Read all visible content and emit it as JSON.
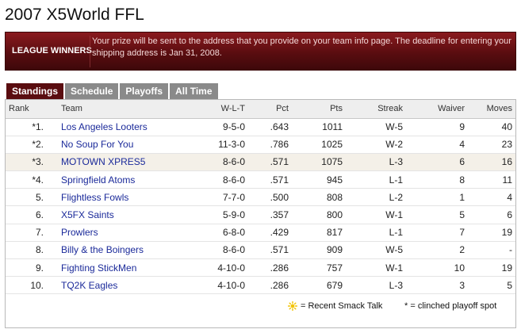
{
  "page": {
    "title": "2007 X5World FFL"
  },
  "banner": {
    "label": "LEAGUE WINNERS",
    "message": "Your prize will be sent to the address that you provide on your team info page. The deadline for entering your shipping address is Jan 31, 2008."
  },
  "tabs": [
    {
      "label": "Standings",
      "active": true
    },
    {
      "label": "Schedule",
      "active": false
    },
    {
      "label": "Playoffs",
      "active": false
    },
    {
      "label": "All Time",
      "active": false
    }
  ],
  "table": {
    "headers": {
      "rank": "Rank",
      "team": "Team",
      "wlt": "W-L-T",
      "pct": "Pct",
      "pts": "Pts",
      "streak": "Streak",
      "waiver": "Waiver",
      "moves": "Moves"
    },
    "rows": [
      {
        "rank": "*1.",
        "team": "Los Angeles Looters",
        "wlt": "9-5-0",
        "pct": ".643",
        "pts": "1011",
        "streak": "W-5",
        "waiver": "9",
        "moves": "40"
      },
      {
        "rank": "*2.",
        "team": "No Soup For You",
        "wlt": "11-3-0",
        "pct": ".786",
        "pts": "1025",
        "streak": "W-2",
        "waiver": "4",
        "moves": "23"
      },
      {
        "rank": "*3.",
        "team": "MOTOWN XPRES5",
        "wlt": "8-6-0",
        "pct": ".571",
        "pts": "1075",
        "streak": "L-3",
        "waiver": "6",
        "moves": "16",
        "highlight": true
      },
      {
        "rank": "*4.",
        "team": "Springfield Atoms",
        "wlt": "8-6-0",
        "pct": ".571",
        "pts": "945",
        "streak": "L-1",
        "waiver": "8",
        "moves": "11"
      },
      {
        "rank": "5.",
        "team": "Flightless Fowls",
        "wlt": "7-7-0",
        "pct": ".500",
        "pts": "808",
        "streak": "L-2",
        "waiver": "1",
        "moves": "4"
      },
      {
        "rank": "6.",
        "team": "X5FX Saints",
        "wlt": "5-9-0",
        "pct": ".357",
        "pts": "800",
        "streak": "W-1",
        "waiver": "5",
        "moves": "6"
      },
      {
        "rank": "7.",
        "team": "Prowlers",
        "wlt": "6-8-0",
        "pct": ".429",
        "pts": "817",
        "streak": "L-1",
        "waiver": "7",
        "moves": "19"
      },
      {
        "rank": "8.",
        "team": "Billy & the Boingers",
        "wlt": "8-6-0",
        "pct": ".571",
        "pts": "909",
        "streak": "W-5",
        "waiver": "2",
        "moves": "-"
      },
      {
        "rank": "9.",
        "team": "Fighting StickMen",
        "wlt": "4-10-0",
        "pct": ".286",
        "pts": "757",
        "streak": "W-1",
        "waiver": "10",
        "moves": "19"
      },
      {
        "rank": "10.",
        "team": "TQ2K Eagles",
        "wlt": "4-10-0",
        "pct": ".286",
        "pts": "679",
        "streak": "L-3",
        "waiver": "3",
        "moves": "5"
      }
    ]
  },
  "footer": {
    "smack_icon": "sun-icon",
    "smack_label": "= Recent Smack Talk",
    "clinched_label": "* = clinched playoff spot"
  },
  "colors": {
    "banner_dark": "#5a0d10",
    "active_tab": "#5a0d10",
    "inactive_tab": "#8a8a8a",
    "team_link": "#1b2a9a",
    "smack_icon": "#f2c300"
  }
}
